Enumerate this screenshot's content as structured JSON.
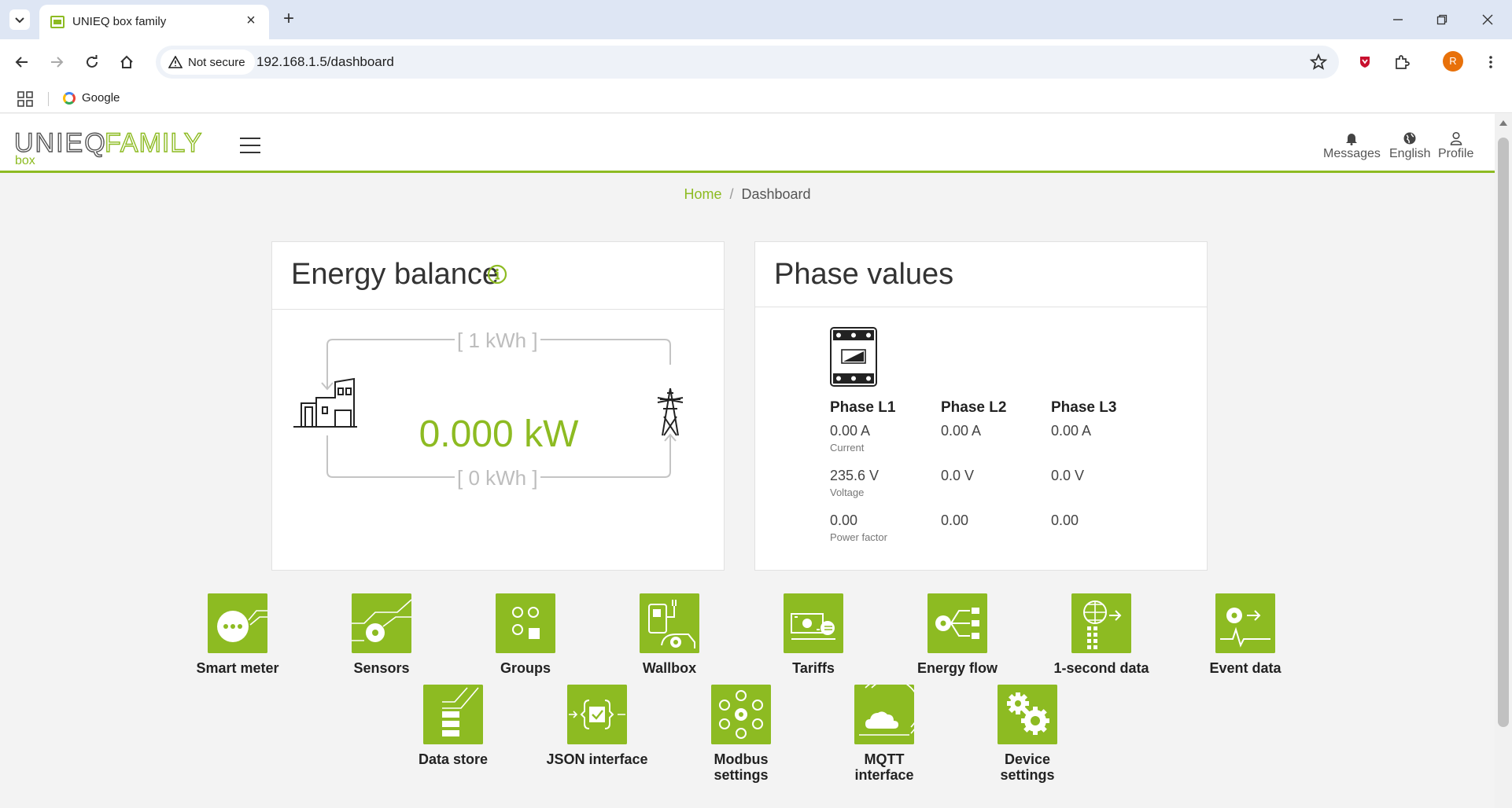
{
  "browser": {
    "tab_title": "UNIEQ box family",
    "security_label": "Not secure",
    "url": "192.168.1.5/dashboard",
    "avatar_initial": "R",
    "bookmark_google": "Google"
  },
  "header": {
    "logo_word1": "UNIEQ",
    "logo_word2": "FAMILY",
    "logo_sub": "box",
    "messages": "Messages",
    "language": "English",
    "profile": "Profile",
    "accent_color": "#8dbb22"
  },
  "breadcrumb": {
    "home": "Home",
    "separator": "/",
    "current": "Dashboard"
  },
  "energy_balance": {
    "title": "Energy balance",
    "top_label": "[ 1 kWh ]",
    "bottom_label": "[ 0 kWh ]",
    "power": "0.000 kW"
  },
  "phase_values": {
    "title": "Phase values",
    "columns": [
      {
        "name": "Phase L1",
        "current": "0.00 A",
        "voltage": "235.6 V",
        "power_factor": "0.00"
      },
      {
        "name": "Phase L2",
        "current": "0.00 A",
        "voltage": "0.0 V",
        "power_factor": "0.00"
      },
      {
        "name": "Phase L3",
        "current": "0.00 A",
        "voltage": "0.0 V",
        "power_factor": "0.00"
      }
    ],
    "labels": {
      "current": "Current",
      "voltage": "Voltage",
      "power_factor": "Power factor"
    }
  },
  "tiles": [
    {
      "label": "Smart meter",
      "icon": "smart-meter-icon"
    },
    {
      "label": "Sensors",
      "icon": "sensors-icon"
    },
    {
      "label": "Groups",
      "icon": "groups-icon"
    },
    {
      "label": "Wallbox",
      "icon": "wallbox-icon"
    },
    {
      "label": "Tariffs",
      "icon": "tariffs-icon"
    },
    {
      "label": "Energy flow",
      "icon": "energy-flow-icon"
    },
    {
      "label": "1-second data",
      "icon": "one-second-data-icon"
    },
    {
      "label": "Event data",
      "icon": "event-data-icon"
    },
    {
      "label": "Data store",
      "icon": "data-store-icon"
    },
    {
      "label": "JSON interface",
      "icon": "json-interface-icon"
    },
    {
      "label": "Modbus\nsettings",
      "icon": "modbus-settings-icon"
    },
    {
      "label": "MQTT\ninterface",
      "icon": "mqtt-interface-icon"
    },
    {
      "label": "Device\nsettings",
      "icon": "device-settings-icon"
    }
  ]
}
